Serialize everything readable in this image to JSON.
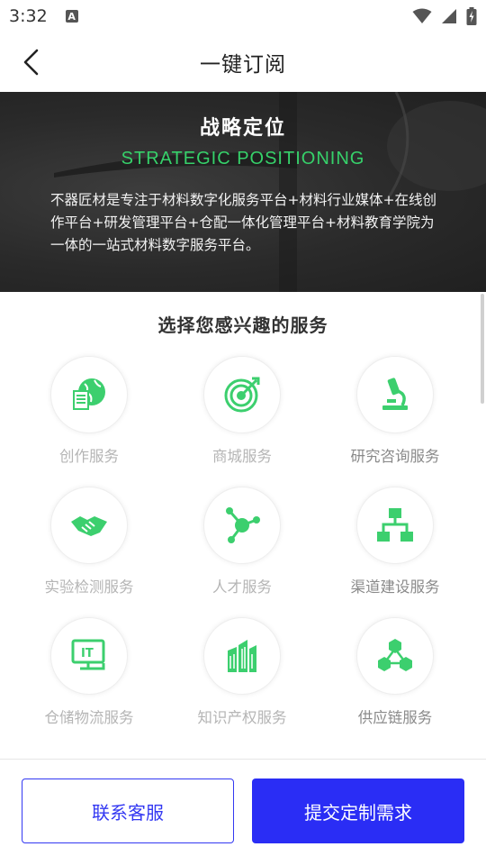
{
  "status_bar": {
    "time": "3:32",
    "notification_icon": "A"
  },
  "nav": {
    "title": "一键订阅",
    "back_icon": "chevron-left-icon"
  },
  "hero": {
    "title": "战略定位",
    "subtitle": "STRATEGIC POSITIONING",
    "description": "不器匠材是专注于材料数字化服务平台+材料行业媒体+在线创作平台+研发管理平台+仓配一体化管理平台+材料教育学院为一体的一站式材料数字服务平台。",
    "accent_color": "#36d16a"
  },
  "services": {
    "heading": "选择您感兴趣的服务",
    "items": [
      {
        "label": "创作服务",
        "icon": "globe-document-icon"
      },
      {
        "label": "商城服务",
        "icon": "target-icon"
      },
      {
        "label": "研究咨询服务",
        "icon": "microscope-icon"
      },
      {
        "label": "实验检测服务",
        "icon": "handshake-icon"
      },
      {
        "label": "人才服务",
        "icon": "network-node-icon"
      },
      {
        "label": "渠道建设服务",
        "icon": "hierarchy-icon"
      },
      {
        "label": "仓储物流服务",
        "icon": "it-monitor-icon"
      },
      {
        "label": "知识产权服务",
        "icon": "building-icon"
      },
      {
        "label": "供应链服务",
        "icon": "hexagon-network-icon"
      }
    ],
    "icon_color": "#3ccf6e"
  },
  "actions": {
    "contact_label": "联系客服",
    "submit_label": "提交定制需求",
    "primary_color": "#2a2df5"
  }
}
